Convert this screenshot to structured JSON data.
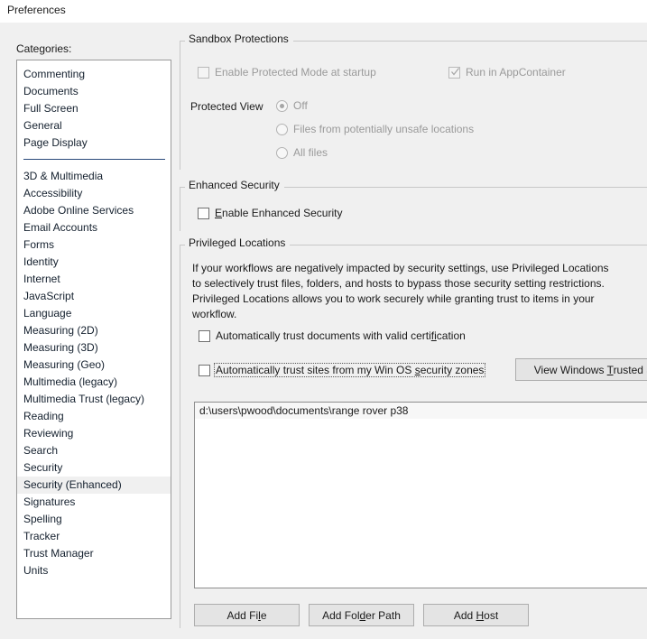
{
  "window": {
    "title": "Preferences"
  },
  "sidebar": {
    "label": "Categories:",
    "label_accesskey": "g",
    "selected": "Security (Enhanced)",
    "group_one": [
      {
        "label": "Commenting"
      },
      {
        "label": "Documents"
      },
      {
        "label": "Full Screen"
      },
      {
        "label": "General"
      },
      {
        "label": "Page Display"
      }
    ],
    "group_two": [
      {
        "label": "3D & Multimedia"
      },
      {
        "label": "Accessibility"
      },
      {
        "label": "Adobe Online Services"
      },
      {
        "label": "Email Accounts"
      },
      {
        "label": "Forms"
      },
      {
        "label": "Identity"
      },
      {
        "label": "Internet"
      },
      {
        "label": "JavaScript"
      },
      {
        "label": "Language"
      },
      {
        "label": "Measuring (2D)"
      },
      {
        "label": "Measuring (3D)"
      },
      {
        "label": "Measuring (Geo)"
      },
      {
        "label": "Multimedia (legacy)"
      },
      {
        "label": "Multimedia Trust (legacy)"
      },
      {
        "label": "Reading"
      },
      {
        "label": "Reviewing"
      },
      {
        "label": "Search"
      },
      {
        "label": "Security"
      },
      {
        "label": "Security (Enhanced)"
      },
      {
        "label": "Signatures"
      },
      {
        "label": "Spelling"
      },
      {
        "label": "Tracker"
      },
      {
        "label": "Trust Manager"
      },
      {
        "label": "Units"
      }
    ]
  },
  "sandbox": {
    "title": "Sandbox Protections",
    "protected_mode_label": "Enable Protected Mode at startup",
    "protected_mode_checked": false,
    "protected_mode_disabled": true,
    "appcontainer_label": "Run in AppContainer",
    "appcontainer_checked": true,
    "appcontainer_disabled": true,
    "protected_view_label": "Protected View",
    "protected_view_selected": "Off",
    "protected_view_options": [
      {
        "label": "Off",
        "selected": true
      },
      {
        "label": "Files from potentially unsafe locations",
        "selected": false
      },
      {
        "label": "All files",
        "selected": false
      }
    ]
  },
  "enhanced_security": {
    "title": "Enhanced Security",
    "enable_label": "Enable Enhanced Security",
    "enable_accesskey": "E",
    "enable_checked": false
  },
  "privileged_locations": {
    "title": "Privileged Locations",
    "description": "If your workflows are negatively impacted by security settings, use Privileged Locations to selectively trust files, folders, and hosts to bypass those security setting restrictions. Privileged Locations allows you to work securely while granting trust to items in your workflow.",
    "auto_trust_docs_label": "Automatically trust documents with valid certification",
    "auto_trust_docs_accesskey": "fi",
    "auto_trust_docs_checked": false,
    "auto_trust_zones_label": "Automatically trust sites from my Win OS security zones",
    "auto_trust_zones_accesskey": "s",
    "auto_trust_zones_checked": false,
    "auto_trust_zones_focused": true,
    "view_trusted_sites_button": "View Windows Trusted Sit",
    "view_trusted_sites_accesskey": "T",
    "locations": [
      {
        "path": "d:\\users\\pwood\\documents\\range rover p38"
      }
    ],
    "buttons": [
      {
        "label": "Add File",
        "accesskey": "l"
      },
      {
        "label": "Add Folder Path",
        "accesskey": "d"
      },
      {
        "label": "Add Host",
        "accesskey": "H"
      }
    ]
  },
  "colors": {
    "window_bg": "#f0f0f0",
    "titlebar_bg": "#ffffff",
    "separator": "#2a4a7a",
    "selection": "#f0f0f0",
    "disabled_text": "#9a9a9a"
  }
}
